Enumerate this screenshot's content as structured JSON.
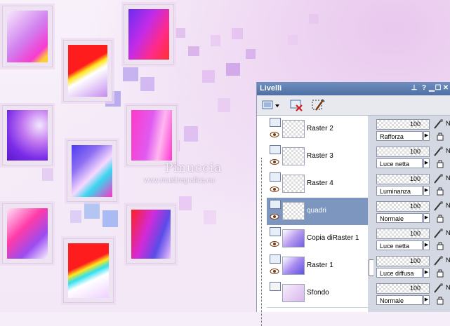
{
  "canvas": {
    "watermark_name": "Pinuccia",
    "watermark_url": "www.maidiregrafica.eu"
  },
  "panel": {
    "title": "Livelli",
    "title_icons": [
      "pin-icon",
      "help-icon",
      "minimize-icon",
      "maximize-icon",
      "close-icon"
    ],
    "toolbar": [
      "new-layer-icon",
      "dropdown-arrow-icon",
      "delete-layer-icon",
      "mask-icon"
    ],
    "layers": [
      {
        "name": "Raster 2",
        "opacity": "100",
        "blend": "Rafforza",
        "selected": false
      },
      {
        "name": "Raster 3",
        "opacity": "100",
        "blend": "Luce netta",
        "selected": false
      },
      {
        "name": "Raster 4",
        "opacity": "100",
        "blend": "Luminanza",
        "selected": false
      },
      {
        "name": "quadri",
        "opacity": "100",
        "blend": "Normale",
        "selected": true
      },
      {
        "name": "Copia diRaster 1",
        "opacity": "100",
        "blend": "Luce netta",
        "selected": false
      },
      {
        "name": "Raster 1",
        "opacity": "100",
        "blend": "Luce diffusa",
        "selected": false
      },
      {
        "name": "Sfondo",
        "opacity": "100",
        "blend": "Normale",
        "selected": false
      }
    ],
    "truncated_label": "Ne"
  },
  "colors": {
    "accent": "#4e6fa3",
    "selected_row": "#7d96c0",
    "panel_bg": "#d4d8e3"
  }
}
